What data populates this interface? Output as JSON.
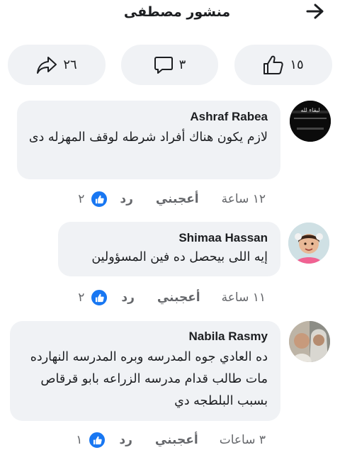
{
  "header": {
    "title": "منشور مصطفى",
    "back_icon": "arrow-right-icon"
  },
  "actions": {
    "likes": {
      "count": "١٥",
      "icon": "thumbs-up-icon"
    },
    "comments": {
      "count": "٣",
      "icon": "comment-icon"
    },
    "shares": {
      "count": "٢٦",
      "icon": "share-icon"
    }
  },
  "comments": [
    {
      "author": "Ashraf Rabea",
      "text": "لازم يكون هناك أفراد شرطه لوقف المهزله دى",
      "time": "١٢ ساعة",
      "like_label": "أعجبني",
      "reply_label": "رد",
      "reactions": "٢",
      "avatar_text": "لبقاء لله"
    },
    {
      "author": "Shimaa Hassan",
      "text": "إيه اللى بيحصل ده فين المسؤولين",
      "time": "١١ ساعة",
      "like_label": "أعجبني",
      "reply_label": "رد",
      "reactions": "٢"
    },
    {
      "author": "Nabila Rasmy",
      "text": "ده العادي جوه المدرسه وبره المدرسه النهارده مات طالب قدام مدرسه الزراعه بابو قرقاص بسبب البلطجه دي",
      "time": "٣ ساعات",
      "like_label": "أعجبني",
      "reply_label": "رد",
      "reactions": "١"
    }
  ],
  "colors": {
    "accent": "#1877f2",
    "bubble": "#f0f2f5",
    "muted": "#65676b"
  }
}
